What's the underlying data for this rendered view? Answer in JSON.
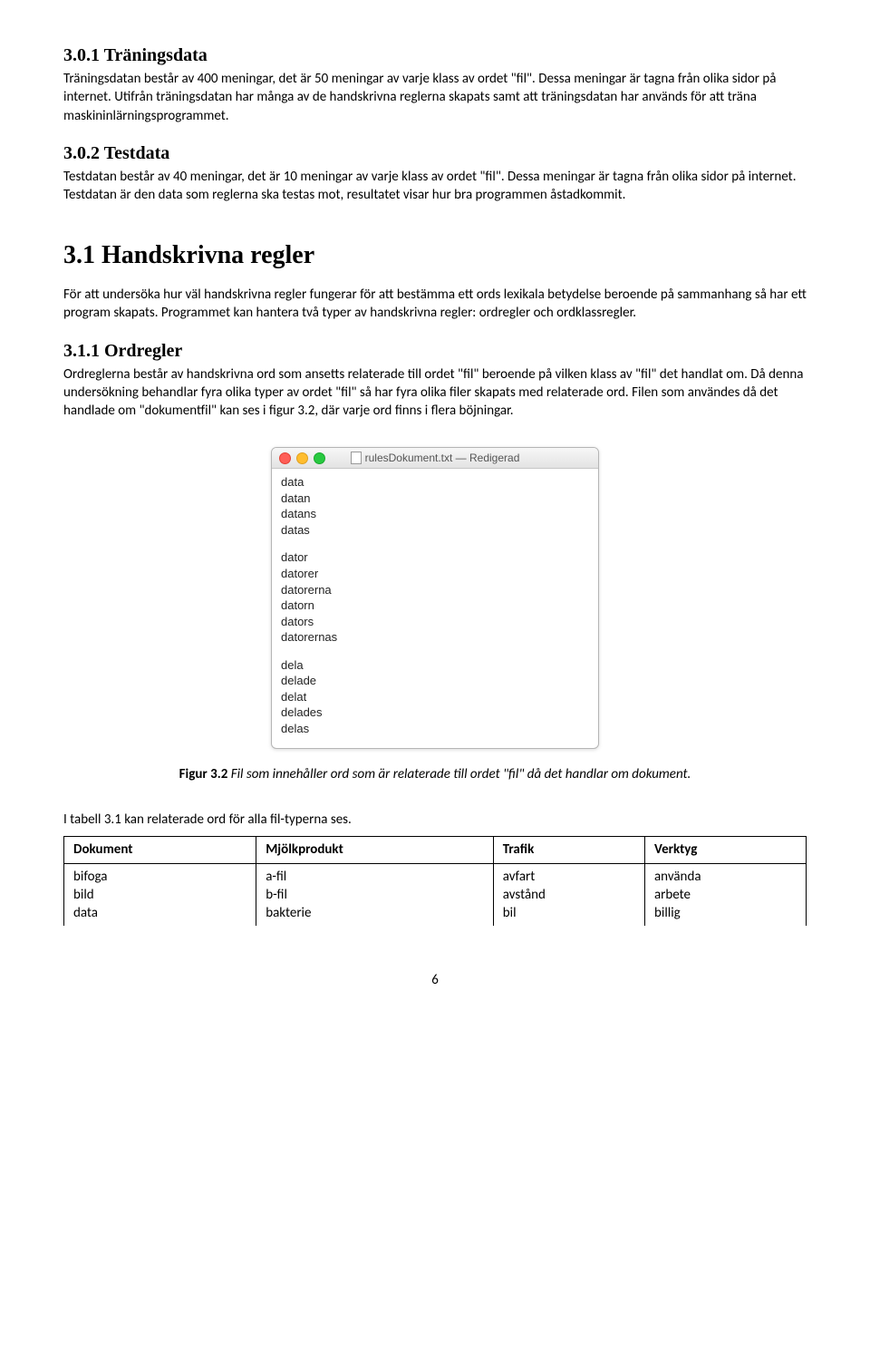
{
  "sections": {
    "s301": {
      "heading": "3.0.1 Träningsdata",
      "p1": "Träningsdatan består av 400 meningar, det är 50 meningar av varje klass av ordet \"fil\". Dessa meningar är tagna från olika sidor på internet. Utifrån träningsdatan har många av de handskrivna reglerna skapats samt att träningsdatan har används för att träna maskininlärningsprogrammet."
    },
    "s302": {
      "heading": "3.0.2 Testdata",
      "p1": "Testdatan består av 40 meningar, det är 10 meningar av varje klass av ordet \"fil\". Dessa meningar är tagna från olika sidor på internet. Testdatan är den data som reglerna ska testas mot, resultatet visar hur bra programmen åstadkommit."
    },
    "s31": {
      "heading": "3.1 Handskrivna regler",
      "p1": "För att undersöka hur väl handskrivna regler fungerar för att bestämma ett ords lexikala betydelse beroende på sammanhang så har ett program skapats. Programmet kan hantera två typer av handskrivna regler: ordregler och ordklassregler."
    },
    "s311": {
      "heading": "3.1.1 Ordregler",
      "p1": "Ordreglerna består av handskrivna ord som ansetts relaterade till ordet \"fil\" beroende på vilken klass av \"fil\" det handlat om. Då denna undersökning behandlar fyra olika typer av ordet \"fil\" så har fyra olika filer skapats med relaterade ord. Filen som användes då det handlade om \"dokumentfil\" kan ses i figur 3.2, där varje ord finns i flera böjningar."
    }
  },
  "mac_window": {
    "title": "rulesDokument.txt — Redigerad",
    "lines": [
      "data",
      "datan",
      "datans",
      "datas",
      "",
      "dator",
      "datorer",
      "datorerna",
      "datorn",
      "dators",
      "datorernas",
      "",
      "dela",
      "delade",
      "delat",
      "delades",
      "delas"
    ]
  },
  "caption": {
    "label": "Figur 3.2",
    "text": " Fil som innehåller ord som är relaterade till ordet \"fil\" då det handlar om dokument."
  },
  "para_after_fig": "I tabell 3.1 kan relaterade ord för alla fil-typerna ses.",
  "table": {
    "headers": [
      "Dokument",
      "Mjölkprodukt",
      "Trafik",
      "Verktyg"
    ],
    "rows": [
      [
        "bifoga",
        "a-fil",
        "avfart",
        "använda"
      ],
      [
        "bild",
        "b-fil",
        "avstånd",
        "arbete"
      ],
      [
        "data",
        "bakterie",
        "bil",
        "billig"
      ]
    ]
  },
  "page_number": "6"
}
